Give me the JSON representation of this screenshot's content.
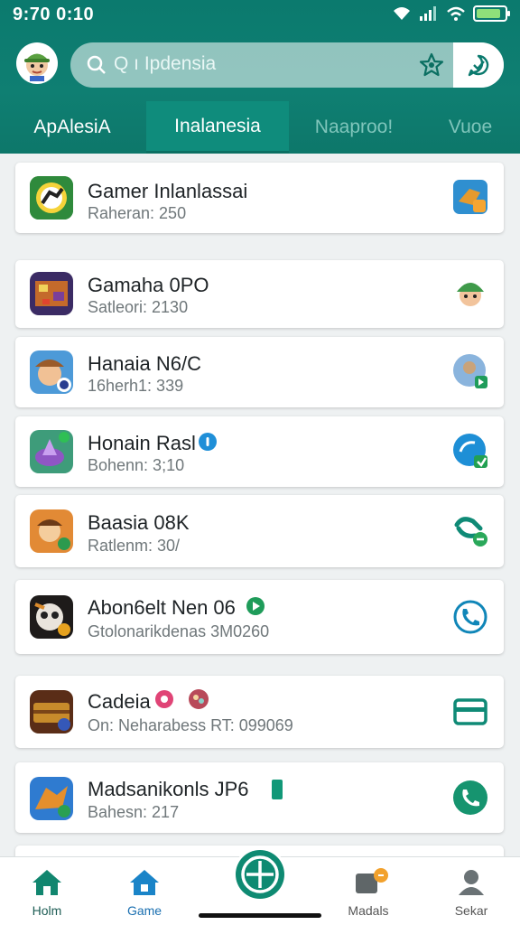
{
  "status": {
    "time": "9:70 0:10"
  },
  "search": {
    "text": "Q ı Ipdensia"
  },
  "tabs": [
    {
      "label": "ApAlesiA",
      "active": false
    },
    {
      "label": "Inalanesia",
      "active": true
    },
    {
      "label": "Naaproo!",
      "active": false
    },
    {
      "label": "Vuoe",
      "active": false
    }
  ],
  "apps": [
    {
      "title": "Gamer Inlanlassai",
      "sub": "Raheran: 250",
      "icon": "ball-game-icon",
      "action": "app-shortcut-icon"
    },
    {
      "title": "Gamaha 0PO",
      "sub": "Satleori: 2130",
      "icon": "pixel-game-icon",
      "action": "character-icon"
    },
    {
      "title": "Hanaia N6/C",
      "sub": "16herh1: 339",
      "icon": "cowboy-game-icon",
      "action": "avatar-badge-icon"
    },
    {
      "title": "Honain Rasl",
      "sub": "Bohenn: 3;10",
      "icon": "crystal-game-icon",
      "action": "share-badge-icon"
    },
    {
      "title": "Baasia 08K",
      "sub": "Ratlenm: 30/",
      "icon": "adventure-game-icon",
      "action": "link-icon"
    },
    {
      "title": "Abon6elt Nen 06",
      "sub": "Gtolonarikdenas 3M0260",
      "icon": "animal-game-icon",
      "action": "phone-icon"
    },
    {
      "title": "Cadeia",
      "sub": "On: Neharabess  RT: 099069",
      "icon": "treasure-game-icon",
      "action": "card-icon"
    },
    {
      "title": "Madsanikonls JP6",
      "sub": "Bahesn: 217",
      "icon": "dragon-game-icon",
      "action": "phone-icon"
    }
  ],
  "nav": [
    {
      "label": "Holm",
      "icon": "home-icon"
    },
    {
      "label": "Game",
      "icon": "game-icon"
    },
    {
      "label": "Madals",
      "icon": "medals-icon"
    },
    {
      "label": "Sekar",
      "icon": "profile-icon"
    }
  ],
  "colors": {
    "primary": "#0f7f72",
    "accent": "#0b9a86",
    "nav_active": "#0a6f9f"
  }
}
